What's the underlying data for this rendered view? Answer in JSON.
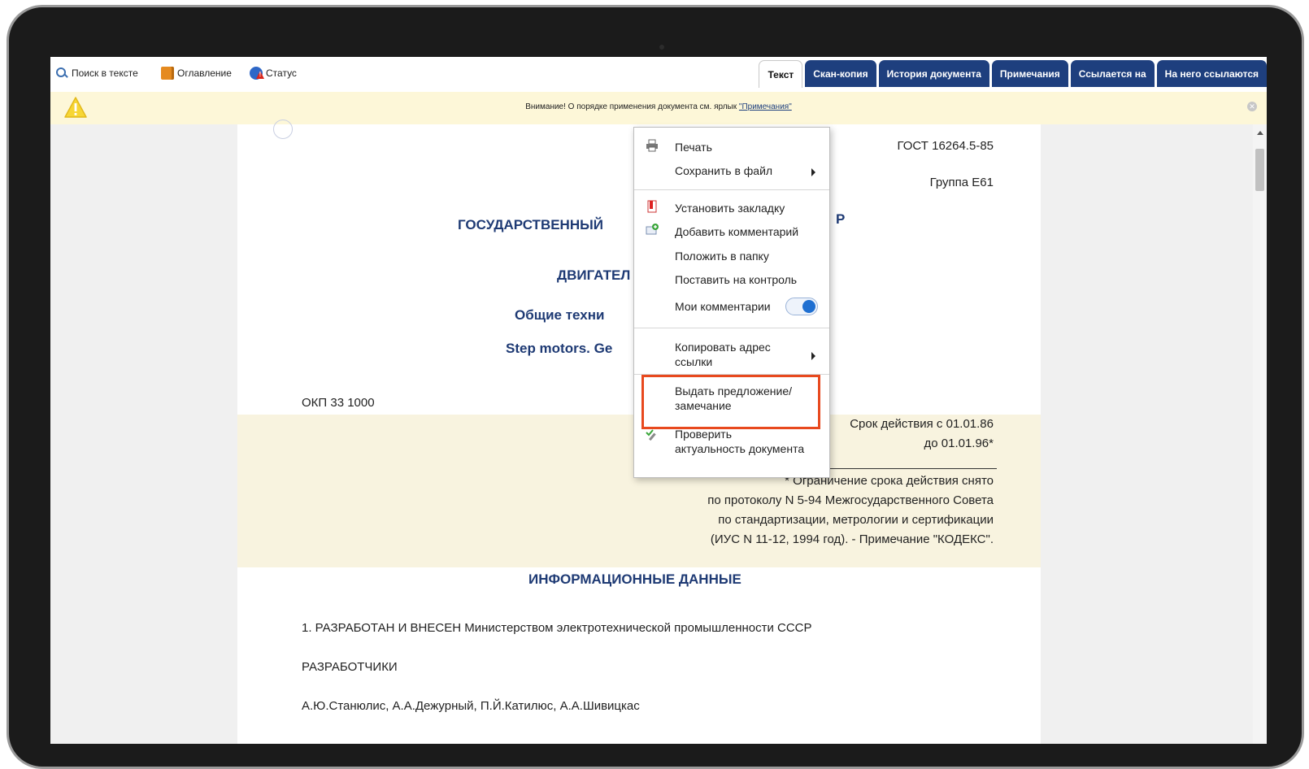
{
  "toolbar": {
    "search_label": "Поиск в тексте",
    "toc_label": "Оглавление",
    "status_label": "Статус"
  },
  "tabs": [
    {
      "label": "Текст",
      "active": true
    },
    {
      "label": "Скан-копия"
    },
    {
      "label": "История документа"
    },
    {
      "label": "Примечания"
    },
    {
      "label": "Ссылается на"
    },
    {
      "label": "На него ссылаются"
    }
  ],
  "notice": {
    "text": "Внимание! О порядке применения документа см. ярлык ",
    "link": "\"Примечания\""
  },
  "document": {
    "gost": "ГОСТ 16264.5-85",
    "group": "Группа Е61",
    "title_line1": "ГОСУДАРСТВЕННЫЙ",
    "title_line1_tail": "Р",
    "title_line2": "ДВИГАТЕЛ",
    "title_line3": "Общие техни",
    "title_line4": "Step motors. Ge",
    "okp": "ОКП 33 1000",
    "validity_line1": "Срок действия с 01.01.86",
    "validity_line2": "до 01.01.96*",
    "note_line1": "* Ограничение срока действия снято",
    "note_line2": "по протоколу N 5-94 Межгосударственного Совета",
    "note_line3": "по стандартизации, метрологии и сертификации",
    "note_line4": "(ИУС N 11-12, 1994 год). - Примечание \"КОДЕКС\".",
    "info_heading": "ИНФОРМАЦИОННЫЕ ДАННЫЕ",
    "para1": "1. РАЗРАБОТАН И ВНЕСЕН Министерством электротехнической промышленности СССР",
    "para2": "РАЗРАБОТЧИКИ",
    "para3": "А.Ю.Станюлис, А.А.Дежурный, П.Й.Катилюс, А.А.Шивицкас"
  },
  "context_menu": {
    "print": "Печать",
    "save_to_file": "Сохранить в файл",
    "set_bookmark": "Установить закладку",
    "add_comment": "Добавить комментарий",
    "put_in_folder": "Положить в папку",
    "put_on_control": "Поставить на контроль",
    "my_comments": "Мои комментарии",
    "my_comments_on": true,
    "copy_link_line1": "Копировать адрес",
    "copy_link_line2": "ссылки",
    "suggest_line1": "Выдать предложение/",
    "suggest_line2": "замечание",
    "check_line1": "Проверить",
    "check_line2": "актуальность документа"
  },
  "colors": {
    "tab_bg": "#1e3f7e",
    "notice_bg": "#fdf7d8",
    "highlight_bg": "#f8f3df",
    "title_color": "#1e3a74",
    "annotation_box": "#e8491e"
  }
}
